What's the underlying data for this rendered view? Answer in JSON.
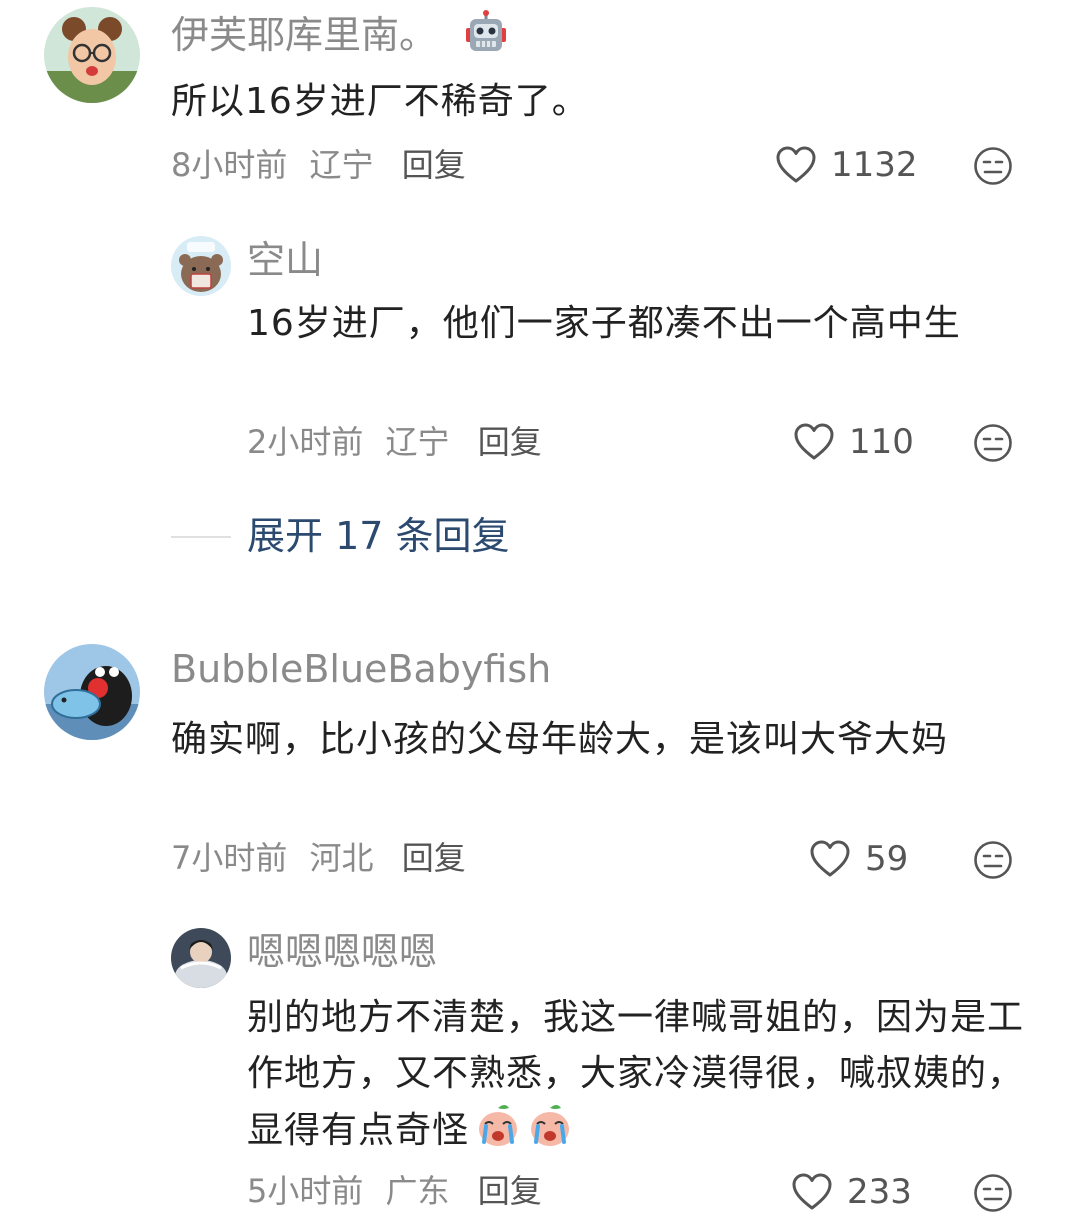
{
  "comments": [
    {
      "username": "伊芙耶库里南。",
      "badge_icon": "robot-icon",
      "text": "所以16岁进厂不稀奇了。",
      "time": "8小时前",
      "location": "辽宁",
      "reply_label": "回复",
      "likes": "1132",
      "replies": [
        {
          "username": "空山",
          "text": "16岁进厂，他们一家子都凑不出一个高中生",
          "time": "2小时前",
          "location": "辽宁",
          "reply_label": "回复",
          "likes": "110"
        }
      ],
      "expand_label": "展开 17 条回复"
    },
    {
      "username": "BubbleBlueBabyfish",
      "text": "确实啊，比小孩的父母年龄大，是该叫大爷大妈",
      "time": "7小时前",
      "location": "河北",
      "reply_label": "回复",
      "likes": "59",
      "replies": [
        {
          "username": "嗯嗯嗯嗯嗯",
          "text": "别的地方不清楚，我这一律喊哥姐的，因为是工作地方，又不熟悉，大家冷漠得很，喊叔姨的，显得有点奇怪",
          "emojis": [
            "crying-peach-emoji",
            "crying-peach-emoji"
          ],
          "time": "5小时前",
          "location": "广东",
          "reply_label": "回复",
          "likes": "233"
        }
      ]
    }
  ],
  "colors": {
    "username": "#8a8a8a",
    "text": "#222222",
    "meta": "#8a8a8a",
    "expand": "#2c4a70"
  }
}
